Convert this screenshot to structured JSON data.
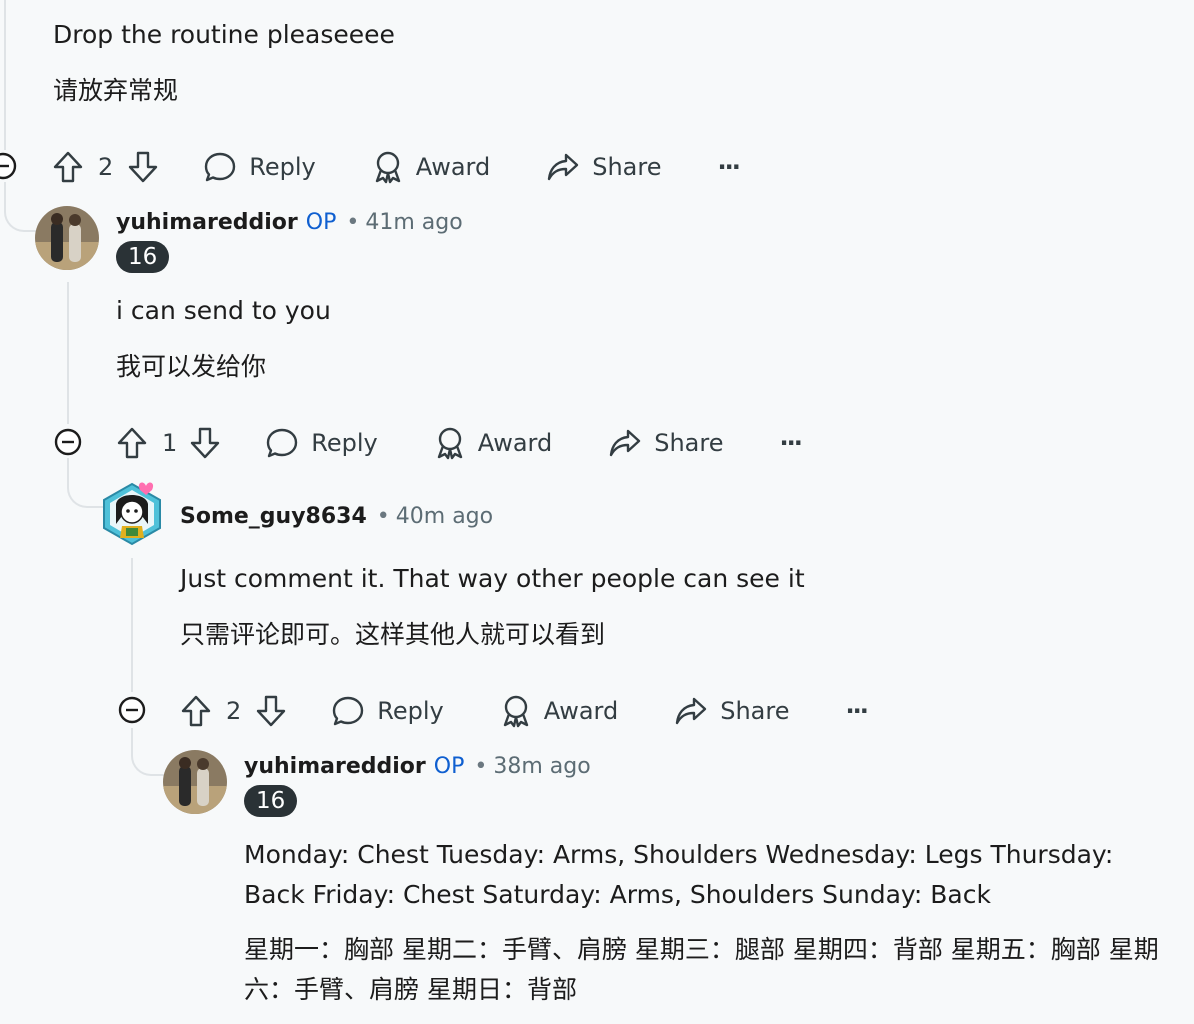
{
  "comments": [
    {
      "body": [
        "Drop the routine pleaseeee",
        "请放弃常规"
      ],
      "actions": {
        "score": "2",
        "reply": "Reply",
        "award": "Award",
        "share": "Share",
        "more": "···"
      }
    },
    {
      "author": "yuhimareddior",
      "op": "OP",
      "separator": "•",
      "time": "41m ago",
      "flair": "16",
      "body": [
        "i can send to you",
        "我可以发给你"
      ],
      "actions": {
        "score": "1",
        "reply": "Reply",
        "award": "Award",
        "share": "Share",
        "more": "···"
      }
    },
    {
      "author": "Some_guy8634",
      "separator": "•",
      "time": "40m ago",
      "body": [
        "Just comment it. That way other people can see it",
        "只需评论即可。这样其他人就可以看到"
      ],
      "actions": {
        "score": "2",
        "reply": "Reply",
        "award": "Award",
        "share": "Share",
        "more": "···"
      }
    },
    {
      "author": "yuhimareddior",
      "op": "OP",
      "separator": "•",
      "time": "38m ago",
      "flair": "16",
      "body": [
        "Monday: Chest Tuesday: Arms, Shoulders Wednesday: Legs Thursday: Back Friday: Chest Saturday: Arms, Shoulders Sunday: Back",
        "星期一：胸部 星期二：手臂、肩膀 星期三：腿部 星期四：背部 星期五：胸部 星期六：手臂、肩膀 星期日：背部"
      ]
    }
  ]
}
